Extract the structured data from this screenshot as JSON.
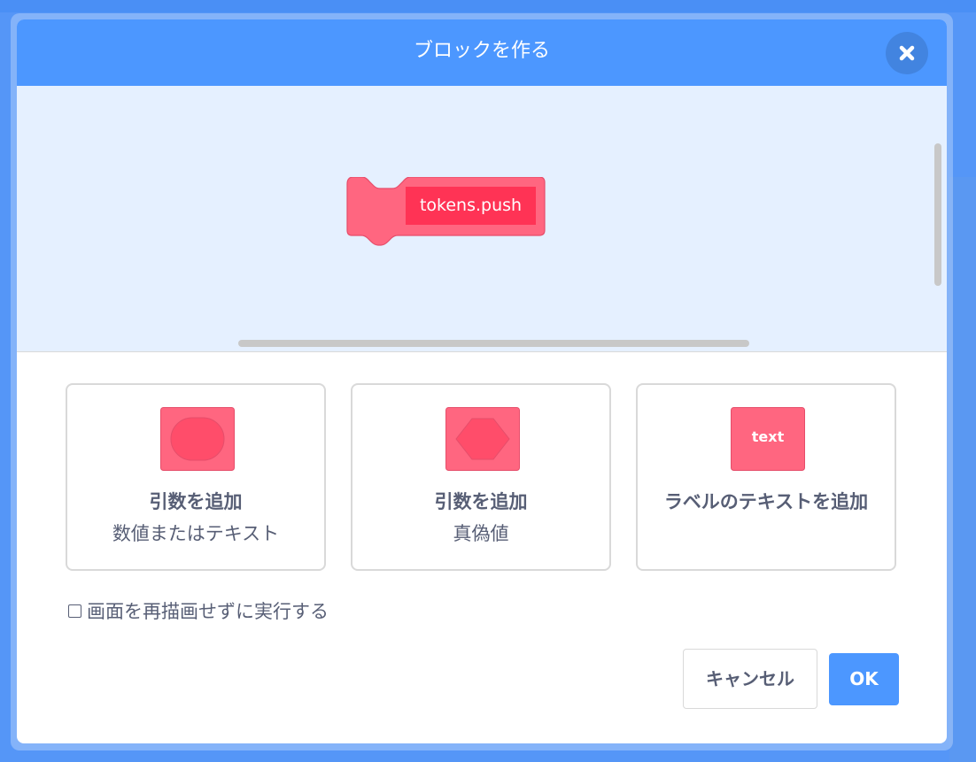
{
  "dialog": {
    "title": "ブロックを作る",
    "close_icon": "close-icon"
  },
  "block_preview": {
    "label_value": "tokens.push",
    "block_color": "#ff6680",
    "input_color": "#ff3355"
  },
  "options": [
    {
      "icon": "round-input-icon",
      "title": "引数を追加",
      "subtitle": "数値またはテキスト"
    },
    {
      "icon": "boolean-input-icon",
      "title": "引数を追加",
      "subtitle": "真偽値"
    },
    {
      "icon": "text-label-icon",
      "icon_text": "text",
      "title": "ラベルのテキストを追加"
    }
  ],
  "run_without_refresh": {
    "label": "画面を再描画せずに実行する",
    "checked": false
  },
  "buttons": {
    "cancel_label": "キャンセル",
    "ok_label": "OK"
  },
  "colors": {
    "header": "#4c97ff",
    "workspace": "#e5f0ff",
    "text": "#575e75"
  }
}
